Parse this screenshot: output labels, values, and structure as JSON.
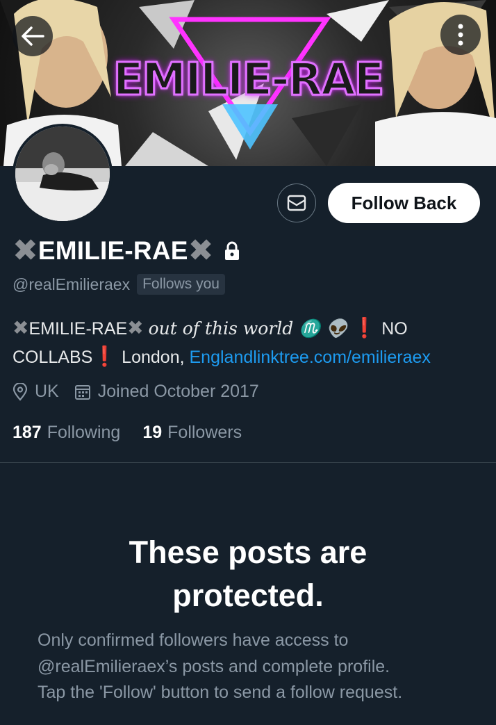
{
  "banner": {
    "title": "EMILIE-RAE"
  },
  "nav": {
    "back_icon": "arrow-left-icon",
    "more_icon": "more-vertical-icon"
  },
  "profile": {
    "name": "EMILIE-RAE",
    "name_decoration": "✖",
    "handle": "@realEmilieraex",
    "follows_you": "Follows you",
    "bio": {
      "deco": "✖",
      "name": "EMILIE-RAE",
      "script": "out of this world ♏ 👽",
      "exclaim": "❗",
      "no": "NO",
      "collabs": "COLLABS",
      "location": "London,",
      "link": "Englandlinktree.com/emilieraex"
    },
    "location": "UK",
    "joined": "Joined October 2017",
    "following_count": "187",
    "following_label": "Following",
    "followers_count": "19",
    "followers_label": "Followers"
  },
  "actions": {
    "follow_back": "Follow Back",
    "message_icon": "mail-icon"
  },
  "protected": {
    "title_line1": "These posts are",
    "title_line2": "protected.",
    "line1": "Only confirmed followers have access to",
    "line2": "@realEmilieraex’s posts and complete profile.",
    "line3": "Tap the 'Follow' button to send a follow request."
  },
  "colors": {
    "background": "#15202b",
    "link": "#1d9bf0",
    "secondary_text": "#8b98a5",
    "banner_glow": "#d000ff"
  }
}
